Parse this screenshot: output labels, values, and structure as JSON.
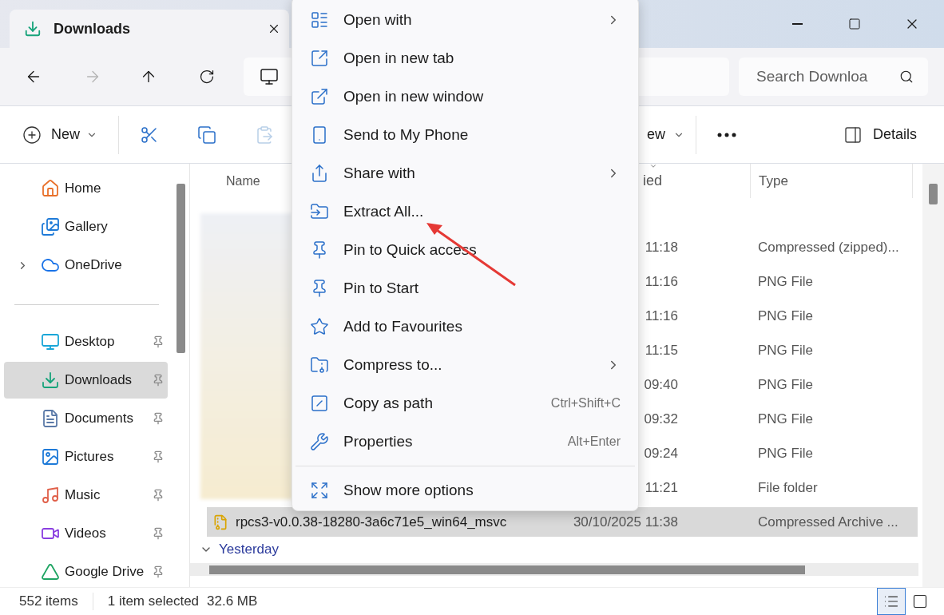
{
  "window": {
    "tab_title": "Downloads"
  },
  "navigation": {
    "forward_disabled": true
  },
  "search": {
    "placeholder": "Search Downloa"
  },
  "command_bar": {
    "new_label": "New",
    "paste_disabled": true,
    "view_label": "ew",
    "details_label": "Details"
  },
  "sidebar": {
    "groups": [
      [
        {
          "label": "Home",
          "selected": false,
          "pinned": false,
          "expandable": false
        },
        {
          "label": "Gallery",
          "selected": false,
          "pinned": false,
          "expandable": false
        },
        {
          "label": "OneDrive",
          "selected": false,
          "pinned": false,
          "expandable": true
        }
      ],
      [
        {
          "label": "Desktop",
          "selected": false,
          "pinned": true,
          "expandable": false
        },
        {
          "label": "Downloads",
          "selected": true,
          "pinned": true,
          "expandable": false
        },
        {
          "label": "Documents",
          "selected": false,
          "pinned": true,
          "expandable": false
        },
        {
          "label": "Pictures",
          "selected": false,
          "pinned": true,
          "expandable": false
        },
        {
          "label": "Music",
          "selected": false,
          "pinned": true,
          "expandable": false
        },
        {
          "label": "Videos",
          "selected": false,
          "pinned": true,
          "expandable": false
        },
        {
          "label": "Google Drive",
          "selected": false,
          "pinned": true,
          "expandable": false
        }
      ]
    ]
  },
  "file_list": {
    "columns": [
      {
        "label": "Name",
        "sorted": false
      },
      {
        "label": "ied",
        "sorted": true
      },
      {
        "label": "Type",
        "sorted": false
      }
    ],
    "rows": [
      {
        "date": "11:18",
        "type": "Compressed (zipped)...",
        "selected": false
      },
      {
        "date": "11:16",
        "type": "PNG File",
        "selected": false
      },
      {
        "date": "11:16",
        "type": "PNG File",
        "selected": false
      },
      {
        "date": "11:15",
        "type": "PNG File",
        "selected": false
      },
      {
        "date": "09:40",
        "type": "PNG File",
        "selected": false
      },
      {
        "date": "09:32",
        "type": "PNG File",
        "selected": false
      },
      {
        "date": "09:24",
        "type": "PNG File",
        "selected": false
      },
      {
        "date": "11:21",
        "type": "File folder",
        "selected": false
      },
      {
        "name": "rpcs3-v0.0.38-18280-3a6c71e5_win64_msvc",
        "date": "30/10/2025 11:38",
        "type": "Compressed Archive ...",
        "selected": true
      }
    ],
    "group": {
      "label": "Yesterday",
      "expanded": true
    }
  },
  "status_bar": {
    "item_count": "552 items",
    "selection": "1 item selected",
    "size": "32.6 MB",
    "views": [
      {
        "selected": true
      },
      {
        "selected": false
      }
    ]
  },
  "context_menu": {
    "items": [
      {
        "label": "Open with",
        "submenu": true
      },
      {
        "label": "Open in new tab",
        "submenu": false
      },
      {
        "label": "Open in new window",
        "submenu": false
      },
      {
        "label": "Send to My Phone",
        "submenu": false
      },
      {
        "label": "Share with",
        "submenu": true
      },
      {
        "label": "Extract All...",
        "submenu": false
      },
      {
        "label": "Pin to Quick access",
        "submenu": false
      },
      {
        "label": "Pin to Start",
        "submenu": false
      },
      {
        "label": "Add to Favourites",
        "submenu": false
      },
      {
        "label": "Compress to...",
        "submenu": true
      },
      {
        "label": "Copy as path",
        "submenu": false,
        "shortcut": "Ctrl+Shift+C"
      },
      {
        "label": "Properties",
        "submenu": false,
        "shortcut": "Alt+Enter"
      }
    ],
    "footer": [
      {
        "label": "Show more options",
        "submenu": false
      }
    ]
  }
}
